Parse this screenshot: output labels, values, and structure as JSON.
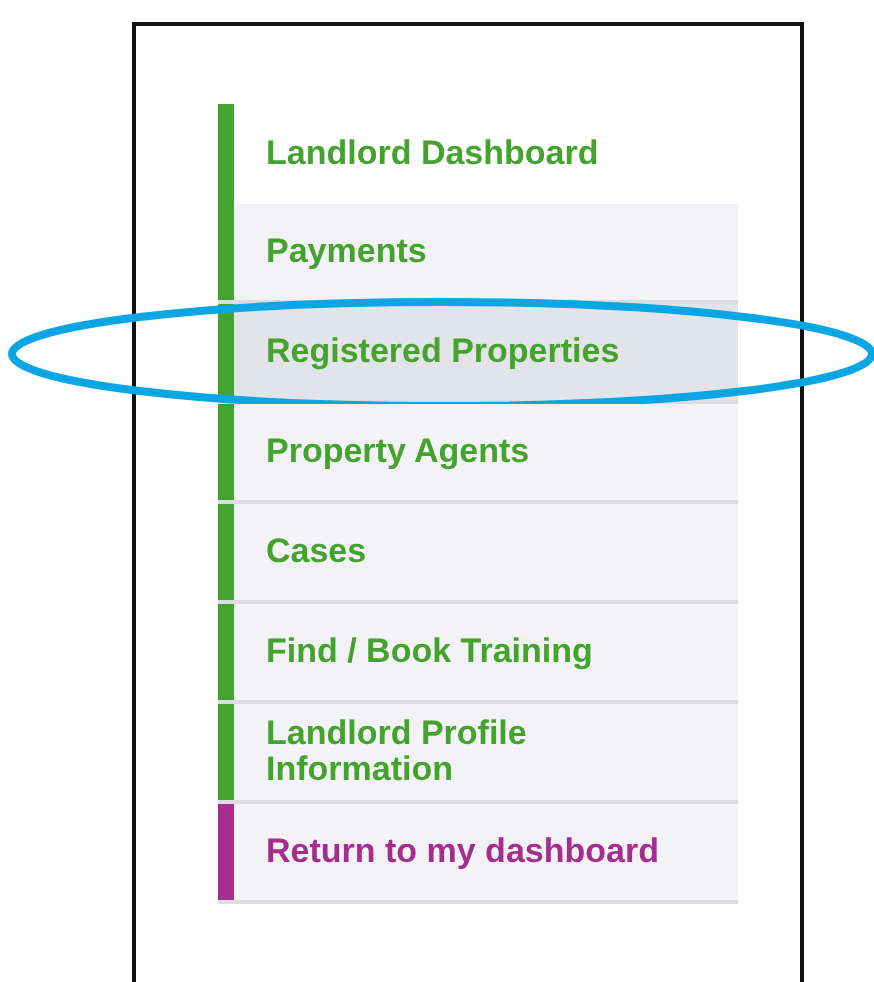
{
  "menu": {
    "items": [
      {
        "label": "Landlord Dashboard",
        "kind": "heading",
        "selected": false,
        "circled": false,
        "color": "#44a32c"
      },
      {
        "label": "Payments",
        "kind": "link",
        "selected": false,
        "circled": false,
        "color": "#44a32c"
      },
      {
        "label": "Registered Properties",
        "kind": "link",
        "selected": true,
        "circled": true,
        "color": "#44a32c"
      },
      {
        "label": "Property Agents",
        "kind": "link",
        "selected": false,
        "circled": false,
        "color": "#44a32c"
      },
      {
        "label": "Cases",
        "kind": "link",
        "selected": false,
        "circled": false,
        "color": "#44a32c"
      },
      {
        "label": "Find / Book Training",
        "kind": "link",
        "selected": false,
        "circled": false,
        "color": "#44a32c"
      },
      {
        "label": "Landlord Profile Information",
        "kind": "link",
        "selected": false,
        "circled": false,
        "color": "#44a32c"
      },
      {
        "label": "Return to my dashboard",
        "kind": "link",
        "selected": false,
        "circled": false,
        "color": "#a52d8d"
      }
    ]
  }
}
